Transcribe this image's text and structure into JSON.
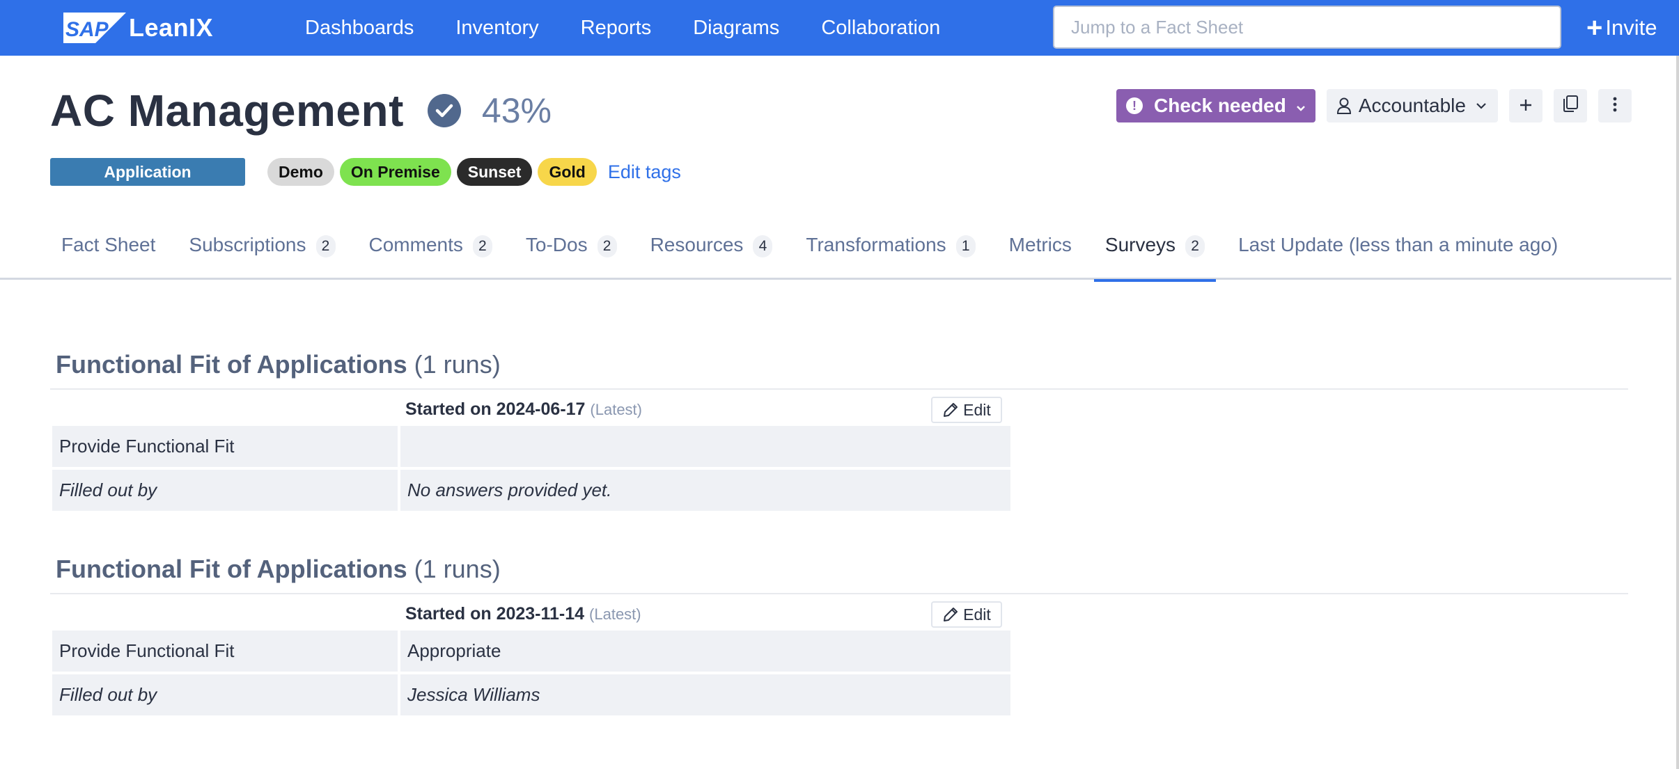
{
  "app": {
    "brand_mark": "SAP",
    "brand_name": "LeanIX",
    "nav": [
      "Dashboards",
      "Inventory",
      "Reports",
      "Diagrams",
      "Collaboration"
    ],
    "search_placeholder": "Jump to a Fact Sheet",
    "search_value": "",
    "invite_label": "Invite",
    "brand_color": "#2f70e8"
  },
  "factsheet": {
    "title": "AC Management",
    "verified_icon": "check-circle-icon",
    "completion": "43%",
    "type": "Application",
    "type_color": "#3a7cb1",
    "tags": [
      {
        "label": "Demo",
        "bg": "#d9d9d9",
        "fg": "#111111"
      },
      {
        "label": "On Premise",
        "bg": "#7ee24f",
        "fg": "#111111"
      },
      {
        "label": "Sunset",
        "bg": "#2b2b2b",
        "fg": "#ffffff"
      },
      {
        "label": "Gold",
        "bg": "#f7d64a",
        "fg": "#111111"
      }
    ],
    "edit_tags_label": "Edit tags",
    "actions": {
      "quality_state": "Check needed",
      "quality_color": "#8a5eb0",
      "role": "Accountable"
    }
  },
  "tabs": [
    {
      "label": "Fact Sheet",
      "count": null,
      "active": false
    },
    {
      "label": "Subscriptions",
      "count": "2",
      "active": false
    },
    {
      "label": "Comments",
      "count": "2",
      "active": false
    },
    {
      "label": "To-Dos",
      "count": "2",
      "active": false
    },
    {
      "label": "Resources",
      "count": "4",
      "active": false
    },
    {
      "label": "Transformations",
      "count": "1",
      "active": false
    },
    {
      "label": "Metrics",
      "count": null,
      "active": false
    },
    {
      "label": "Surveys",
      "count": "2",
      "active": true
    },
    {
      "label": "Last Update (less than a minute ago)",
      "count": null,
      "active": false
    }
  ],
  "surveys": [
    {
      "title": "Functional Fit of Applications",
      "runs": "(1 runs)",
      "run_label": "Started on 2024-06-17",
      "run_latest": "(Latest)",
      "edit_label": "Edit",
      "rows": [
        {
          "question": "Provide Functional Fit",
          "answer": "",
          "italic": false
        },
        {
          "question": "Filled out by",
          "answer": "No answers provided yet.",
          "italic": true
        }
      ]
    },
    {
      "title": "Functional Fit of Applications",
      "runs": "(1 runs)",
      "run_label": "Started on 2023-11-14",
      "run_latest": "(Latest)",
      "edit_label": "Edit",
      "rows": [
        {
          "question": "Provide Functional Fit",
          "answer": "Appropriate",
          "italic": false
        },
        {
          "question": "Filled out by",
          "answer": "Jessica Williams",
          "italic": true
        }
      ]
    }
  ]
}
